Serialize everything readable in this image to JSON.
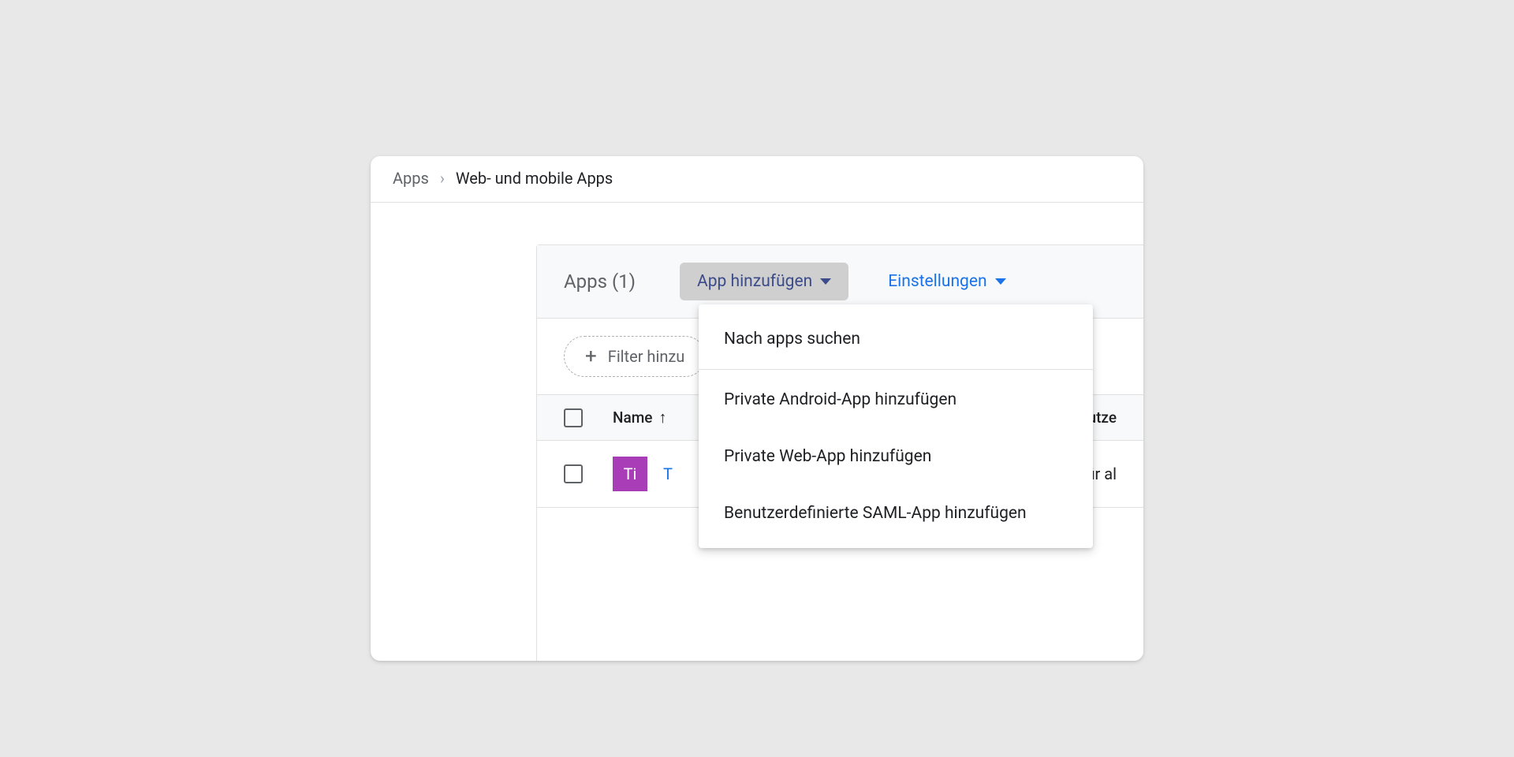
{
  "breadcrumb": {
    "root": "Apps",
    "current": "Web- und mobile Apps"
  },
  "toolbar": {
    "title": "Apps (1)",
    "add_app_label": "App hinzufügen",
    "settings_label": "Einstellungen"
  },
  "filter": {
    "label": "Filter hinzu"
  },
  "table": {
    "col_name": "Name",
    "col_user": "Nutze",
    "row": {
      "icon_text": "Ti",
      "name_prefix": "T",
      "user_value": "Für al"
    }
  },
  "dropdown": {
    "items": [
      "Nach apps suchen",
      "Private Android-App hinzufügen",
      "Private Web-App hinzufügen",
      "Benutzerdefinierte SAML-App hinzufügen"
    ]
  },
  "colors": {
    "accent": "#1a73e8",
    "app_icon": "#a93db8"
  }
}
